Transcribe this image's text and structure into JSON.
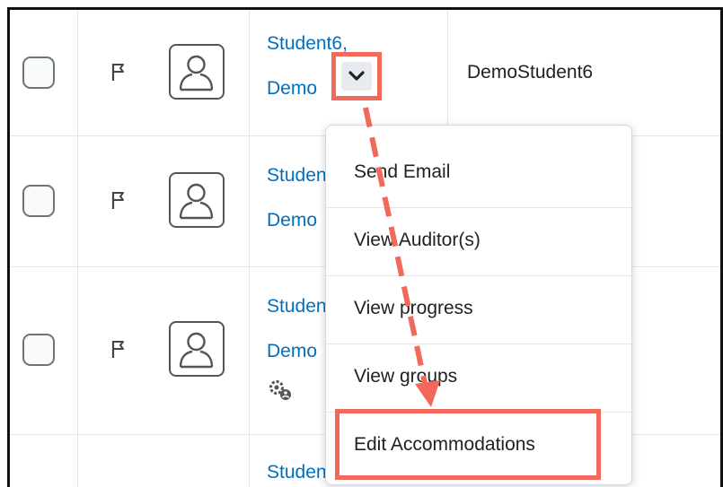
{
  "rows": [
    {
      "name_line1": "Student6,",
      "name_line2": "Demo",
      "org_id": "DemoStudent6"
    },
    {
      "name_line1": "Studen",
      "name_line2": "Demo"
    },
    {
      "name_line1": "Studen",
      "name_line2": "Demo"
    },
    {
      "name_line1": "Studen"
    }
  ],
  "menu": {
    "items": [
      "Send Email",
      "View Auditor(s)",
      "View progress",
      "View groups",
      "Edit Accommodations"
    ]
  },
  "colors": {
    "highlight": "#f2685a",
    "link": "#006fbf"
  },
  "icons": [
    "flag-icon",
    "user-avatar-icon",
    "chevron-down-icon",
    "accommodations-gear-icon"
  ]
}
